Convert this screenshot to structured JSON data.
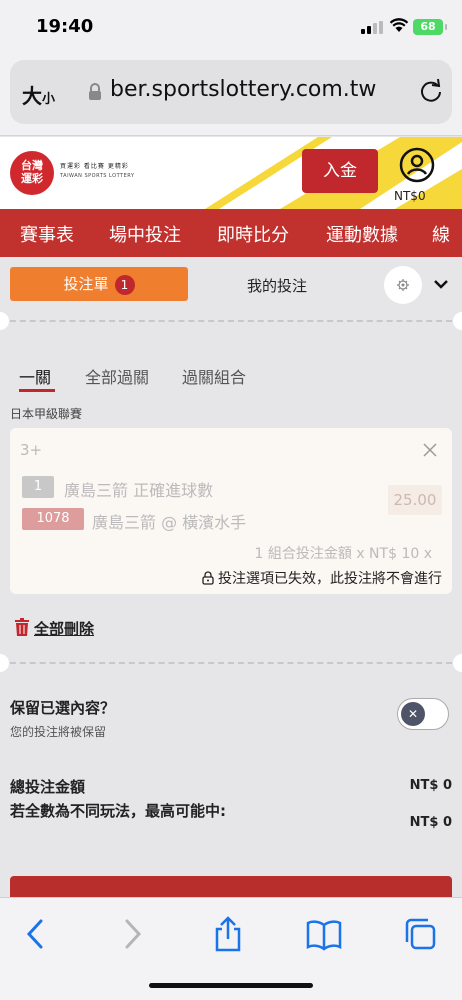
{
  "status_bar": {
    "time": "19:40",
    "battery": "68"
  },
  "browser": {
    "text_size_label": "大",
    "text_size_small": "小",
    "url": "ber.sportslottery.com.tw"
  },
  "site": {
    "logo_text_line1": "台灣",
    "logo_text_line2": "運彩",
    "logo_tagline": "買運彩  看比賽  更精彩",
    "logo_subtitle": "TAIWAN SPORTS LOTTERY",
    "deposit_label": "入金",
    "balance": "NT$0"
  },
  "nav": {
    "items": [
      "賽事表",
      "場中投注",
      "即時比分",
      "運動數據",
      "線"
    ]
  },
  "slip": {
    "tab_label": "投注單",
    "tab_count": "1",
    "my_bets_label": "我的投注",
    "bet_types": [
      "一關",
      "全部過關",
      "過關組合"
    ],
    "active_bet_type": "一關",
    "league": "日本甲級聯賽",
    "card": {
      "combo": "3+",
      "selections": [
        {
          "badge": "1",
          "text": "廣島三箭 正確進球數"
        },
        {
          "badge": "1078",
          "text": "廣島三箭 @ 橫濱水手"
        }
      ],
      "odds": "25.00",
      "stake_text": "1 組合投注金額 x NT$ 10 x",
      "invalid_text": "投注選項已失效，此投注將不會進行"
    },
    "delete_all": "全部刪除",
    "keep_question": "保留已選內容？",
    "keep_sub": "您的投注將被保留",
    "keep_enabled": false,
    "total_label": "總投注金額",
    "total_value": "NT$ 0",
    "max_win_label": "若全數為不同玩法，最高可能中:",
    "max_win_value": "NT$ 0"
  },
  "colors": {
    "brand_red": "#c1322f",
    "accent_orange": "#ef7f2f",
    "ios_blue": "#1a73e8"
  },
  "toolbar_icons": [
    "back-icon",
    "forward-icon",
    "share-icon",
    "bookmarks-icon",
    "tabs-icon"
  ]
}
